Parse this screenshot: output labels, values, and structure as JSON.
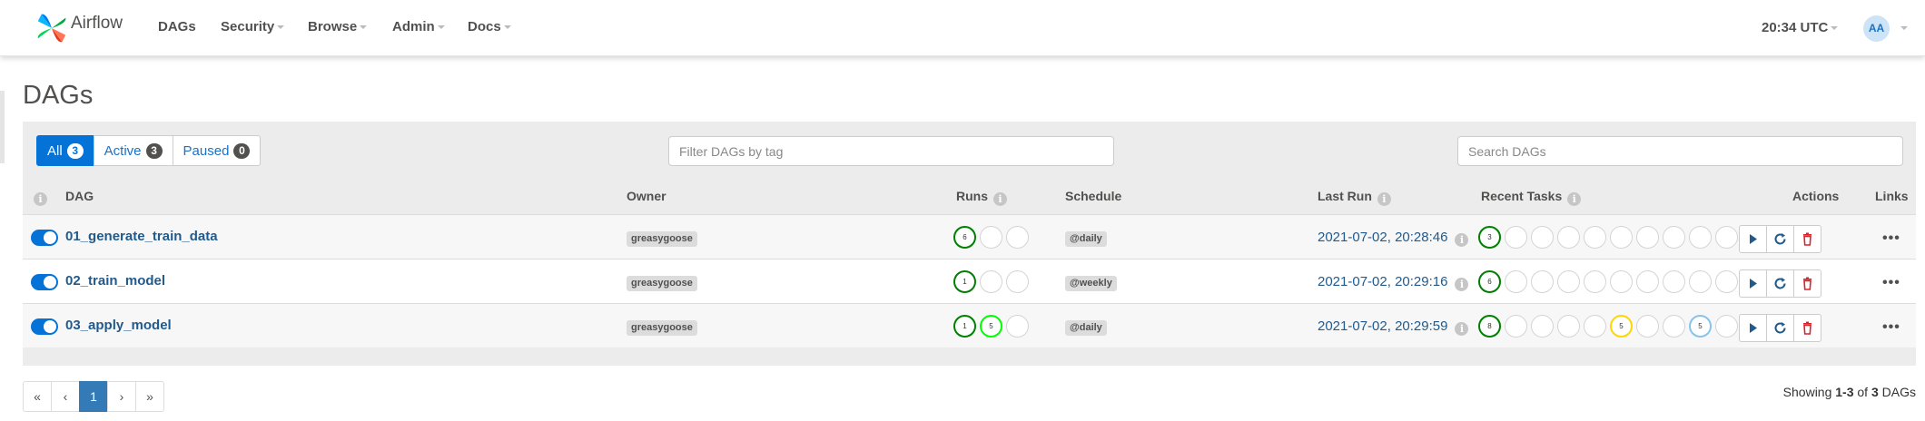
{
  "navbar": {
    "brand": "Airflow",
    "items": [
      "DAGs",
      "Security",
      "Browse",
      "Admin",
      "Docs"
    ],
    "time": "20:34 UTC",
    "user_initials": "AA"
  },
  "page": {
    "title": "DAGs"
  },
  "filters": {
    "all_label": "All",
    "all_count": "3",
    "active_label": "Active",
    "active_count": "3",
    "paused_label": "Paused",
    "paused_count": "0",
    "tag_placeholder": "Filter DAGs by tag",
    "search_placeholder": "Search DAGs"
  },
  "columns": {
    "dag": "DAG",
    "owner": "Owner",
    "runs": "Runs",
    "schedule": "Schedule",
    "last_run": "Last Run",
    "recent_tasks": "Recent Tasks",
    "actions": "Actions",
    "links": "Links"
  },
  "dags": [
    {
      "id": "01_generate_train_data",
      "paused": false,
      "owner": "greasygoose",
      "runs": [
        {
          "state": "success",
          "count": "6"
        },
        {
          "state": "none",
          "count": ""
        },
        {
          "state": "none",
          "count": ""
        }
      ],
      "schedule": "@daily",
      "last_run": "2021-07-02, 20:28:46",
      "tasks": [
        {
          "state": "success",
          "count": "3"
        },
        {
          "state": "none",
          "count": ""
        },
        {
          "state": "none",
          "count": ""
        },
        {
          "state": "none",
          "count": ""
        },
        {
          "state": "none",
          "count": ""
        },
        {
          "state": "none",
          "count": ""
        },
        {
          "state": "none",
          "count": ""
        },
        {
          "state": "none",
          "count": ""
        },
        {
          "state": "none",
          "count": ""
        },
        {
          "state": "none",
          "count": ""
        },
        {
          "state": "none",
          "count": ""
        }
      ]
    },
    {
      "id": "02_train_model",
      "paused": false,
      "owner": "greasygoose",
      "runs": [
        {
          "state": "success",
          "count": "1"
        },
        {
          "state": "none",
          "count": ""
        },
        {
          "state": "none",
          "count": ""
        }
      ],
      "schedule": "@weekly",
      "last_run": "2021-07-02, 20:29:16",
      "tasks": [
        {
          "state": "success",
          "count": "6"
        },
        {
          "state": "none",
          "count": ""
        },
        {
          "state": "none",
          "count": ""
        },
        {
          "state": "none",
          "count": ""
        },
        {
          "state": "none",
          "count": ""
        },
        {
          "state": "none",
          "count": ""
        },
        {
          "state": "none",
          "count": ""
        },
        {
          "state": "none",
          "count": ""
        },
        {
          "state": "none",
          "count": ""
        },
        {
          "state": "none",
          "count": ""
        },
        {
          "state": "none",
          "count": ""
        }
      ]
    },
    {
      "id": "03_apply_model",
      "paused": false,
      "owner": "greasygoose",
      "runs": [
        {
          "state": "success",
          "count": "1"
        },
        {
          "state": "running",
          "count": "5"
        },
        {
          "state": "none",
          "count": ""
        }
      ],
      "schedule": "@daily",
      "last_run": "2021-07-02, 20:29:59",
      "tasks": [
        {
          "state": "success",
          "count": "8"
        },
        {
          "state": "none",
          "count": ""
        },
        {
          "state": "none",
          "count": ""
        },
        {
          "state": "none",
          "count": ""
        },
        {
          "state": "none",
          "count": ""
        },
        {
          "state": "up_for_retry",
          "count": "5"
        },
        {
          "state": "none",
          "count": ""
        },
        {
          "state": "none",
          "count": ""
        },
        {
          "state": "queued",
          "count": "5"
        },
        {
          "state": "none",
          "count": ""
        },
        {
          "state": "none",
          "count": ""
        }
      ]
    }
  ],
  "pagination": {
    "first": "«",
    "prev": "‹",
    "current": "1",
    "next": "›",
    "last": "»"
  },
  "summary": {
    "prefix": "Showing",
    "range": "1-3",
    "of": "of",
    "total": "3",
    "suffix": "DAGs"
  },
  "colors": {
    "primary": "#0572d8",
    "success": "#008000",
    "running": "#00ff00",
    "up_for_retry": "#ffd700",
    "queued": "#88c3e8",
    "delete": "#d9232d",
    "link": "#225a8c"
  }
}
